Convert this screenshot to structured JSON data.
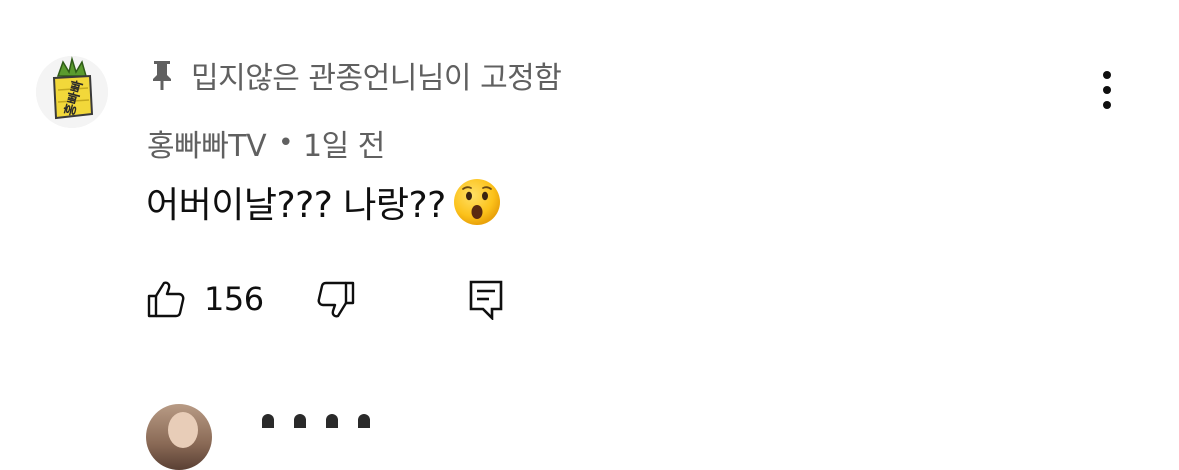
{
  "comment": {
    "channel_logo_text": "홍빠빠",
    "pinned_label": "밉지않은 관종언니님이 고정함",
    "author": "홍빠빠TV",
    "separator": "•",
    "time_ago": "1일 전",
    "text": "어버이날??? 나랑??",
    "emoji": "😮",
    "like_count": "156"
  },
  "icons": {
    "pin": "pin-icon",
    "more": "more-vertical-icon",
    "like": "thumbs-up-icon",
    "dislike": "thumbs-down-icon",
    "reply": "reply-icon"
  },
  "colors": {
    "primary_text": "#0f0f0f",
    "secondary_text": "#606060",
    "logo_yellow": "#f2d83a",
    "logo_green": "#5a9b2e"
  }
}
